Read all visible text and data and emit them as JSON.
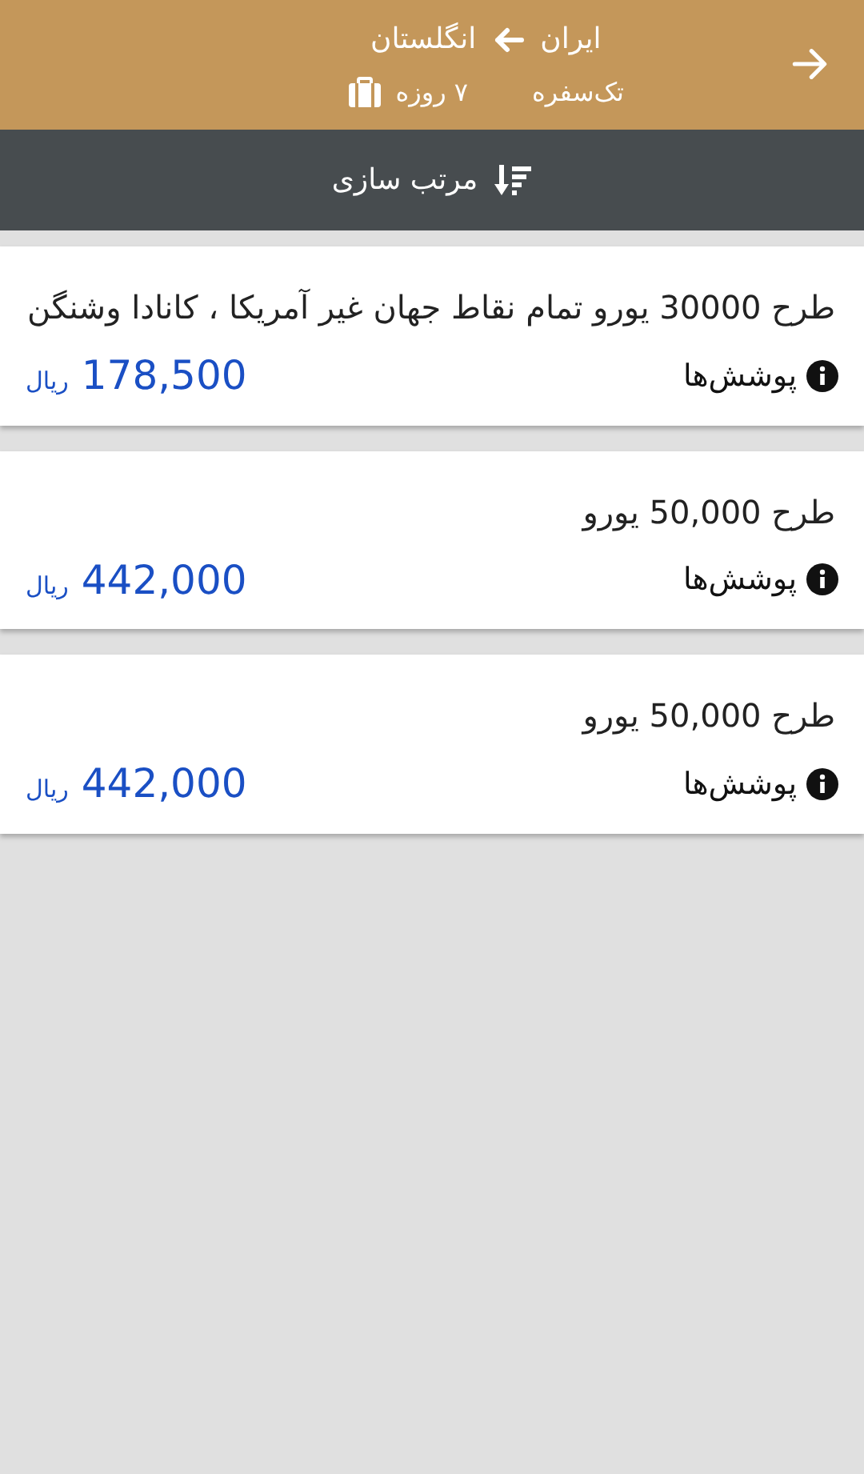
{
  "header": {
    "origin": "ایران",
    "destination": "انگلستان",
    "trip_type": "تک‌سفره",
    "duration": "۷ روزه"
  },
  "sort_bar": {
    "label": "مرتب سازی"
  },
  "plans": [
    {
      "title": "طرح   30000 یورو  تمام نقاط جهان غیر آمریکا ، کانادا وشنگن",
      "coverage_label": "پوشش‌ها",
      "price": "178,500",
      "currency": "ریال"
    },
    {
      "title": "طرح 50,000 یورو",
      "coverage_label": "پوشش‌ها",
      "price": "442,000",
      "currency": "ریال"
    },
    {
      "title": "طرح 50,000 یورو",
      "coverage_label": "پوشش‌ها",
      "price": "442,000",
      "currency": "ریال"
    }
  ]
}
